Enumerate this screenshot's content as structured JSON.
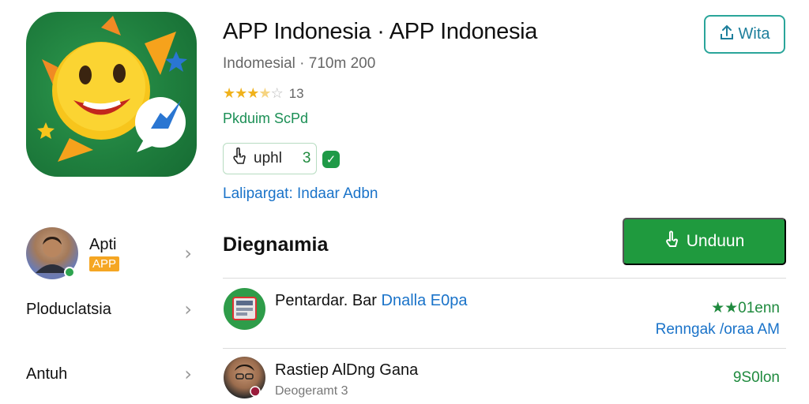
{
  "app": {
    "title": "APP Indonesia · APP Indonesia",
    "subtitle": "Indomesial · 710m 200",
    "rating_count": "13",
    "publisher": "Pkduim ScPd",
    "upvote_label": "uphl",
    "upvote_count": "3",
    "category": "Lalipargat: Indaar Adbn"
  },
  "stars": {
    "value": 3.5,
    "max": 5
  },
  "actions": {
    "share_label": "Wita",
    "install_label": "Unduun"
  },
  "section": {
    "title": "Diegnaımia"
  },
  "sidebar": {
    "developer": {
      "name": "Apti",
      "tag": "APP"
    },
    "items": [
      {
        "label": "Ploduclatsia"
      },
      {
        "label": "Antuh"
      }
    ]
  },
  "list": [
    {
      "title": "Pentardar. Bar ",
      "title_highlight": "Dnalla E0pa",
      "subtitle": "",
      "right_top": "★★01enn",
      "right_bottom": "Renngak /oraa AM"
    },
    {
      "title": "Rastiep AlDng Gana",
      "title_highlight": "",
      "subtitle": "Deogeramt 3",
      "right_top": "9S0lon",
      "right_bottom": ""
    }
  ],
  "colors": {
    "accent_green": "#1f9a3e",
    "link_blue": "#1a73c9",
    "star": "#f0b21c"
  },
  "icons": [
    "share-icon",
    "download-icon",
    "hand-pointer-icon",
    "check-icon",
    "chevron-right-icon"
  ]
}
